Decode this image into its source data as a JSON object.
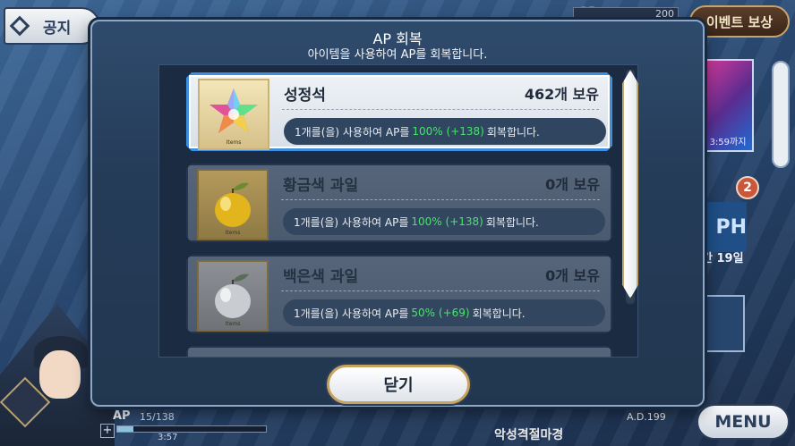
{
  "background": {
    "notice_label": "공지",
    "event_reward_label": "이벤트 보상",
    "top_bar_value": "200",
    "event_banner_time": "3:59까지",
    "badge_count": "2",
    "banner2_text": "PH",
    "banner2_sub": "간 19일",
    "menu_label": "MENU",
    "ap": {
      "label": "AP",
      "value": "15/138",
      "fill_fraction": 0.109,
      "timer": "3:57",
      "plus": "+"
    },
    "bottom_title": "악성격절마경",
    "bottom_date": "A.D.199"
  },
  "modal": {
    "title": "AP 회복",
    "subtitle": "아이템을 사용하여 AP를 회복합니다.",
    "items": [
      {
        "name": "성정석",
        "count": "462개 보유",
        "desc_prefix": "1개를(을) 사용하여 AP를",
        "desc_pct": "100% (+138)",
        "desc_suffix": "회복합니다.",
        "icon": "saint-quartz-icon",
        "icon_tag": "Items"
      },
      {
        "name": "황금색 과일",
        "count": "0개 보유",
        "desc_prefix": "1개를(을) 사용하여 AP를",
        "desc_pct": "100% (+138)",
        "desc_suffix": "회복합니다.",
        "icon": "golden-apple-icon",
        "icon_tag": "Items"
      },
      {
        "name": "백은색 과일",
        "count": "0개 보유",
        "desc_prefix": "1개를(을) 사용하여 AP를",
        "desc_pct": "50% (+69)",
        "desc_suffix": "회복합니다.",
        "icon": "silver-apple-icon",
        "icon_tag": "Items"
      }
    ],
    "close_label": "닫기"
  },
  "colors": {
    "accent_green": "#47e36b",
    "selected_border": "#3e8fe0",
    "gold_trim": "#c7a360"
  }
}
